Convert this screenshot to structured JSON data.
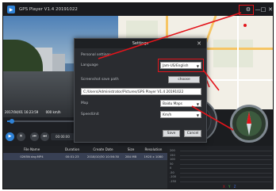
{
  "app": {
    "title": "GPS Player V1.4 20191022",
    "window_controls": [
      "—",
      "□",
      "✕"
    ],
    "accent": "#2f82d6",
    "highlight": "#e3141b"
  },
  "video": {
    "osd_datetime": "2017/04/01 16:23:59",
    "osd_speed": "000 km/h",
    "progress": 0.04,
    "time": "00:00:00"
  },
  "file_table": {
    "columns": [
      "File Name",
      "Duration",
      "Create Date",
      "Size",
      "Resolution"
    ],
    "rows": [
      [
        "0265N day.MP4",
        "00:01:23",
        "2018/10/30 10:56:30",
        "284 MB",
        "1920 x 1080"
      ]
    ]
  },
  "graph": {
    "ticks": [
      "200",
      "150",
      "100",
      "50",
      "0",
      "-50",
      "-100",
      "-150"
    ],
    "legend": {
      "x": "X",
      "y": "Y",
      "z": "Z"
    },
    "colors": {
      "x": "#e3141b",
      "y": "#3fbf3f",
      "z": "#3f6fdf"
    }
  },
  "settings": {
    "title": "Settings",
    "section": "Personal settings",
    "language_label": "Language",
    "language_value": "Jam-US/English",
    "screenshot_label": "Screenshot save path",
    "choose_button": "choose",
    "path_value": "C:/Users/Administrator/Pictures/GPS Player V1.4 20191022",
    "map_label": "Map",
    "map_value": "Baidu Maps",
    "speed_label": "SpeedUnit",
    "speed_value": "Km/h",
    "save_button": "Save",
    "cancel_button": "Cancel"
  }
}
